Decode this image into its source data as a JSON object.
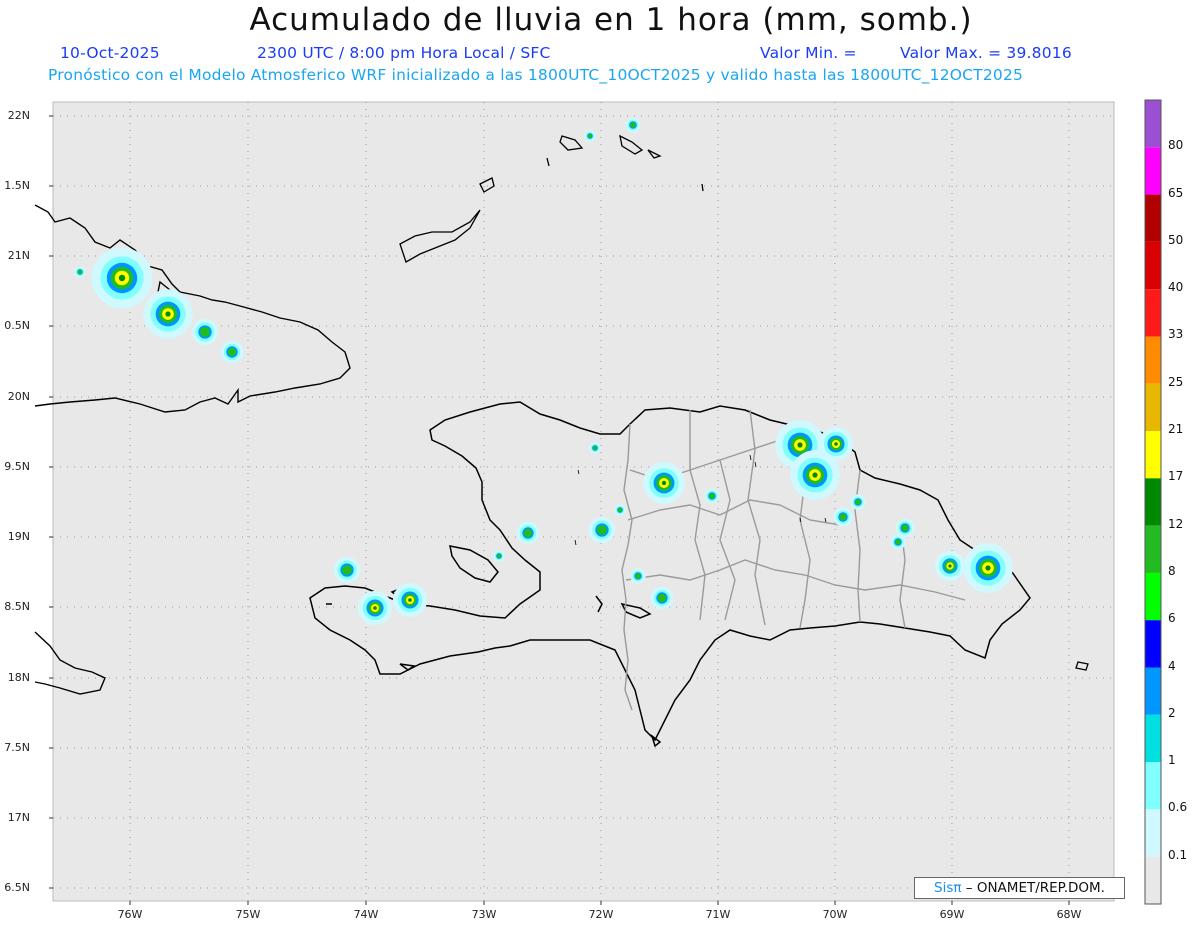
{
  "header": {
    "title": "Acumulado de lluvia en 1 hora (mm, somb.)",
    "date": "10-Oct-2025",
    "time": "2300 UTC / 8:00 pm Hora Local / SFC",
    "min_label": "Valor Min. =",
    "max_label": "Valor Max. = 39.8016",
    "subtitle": "Pronóstico con el Modelo Atmosferico WRF inicializado a las 1800UTC_10OCT2025 y valido hasta las  1800UTC_12OCT2025"
  },
  "axes": {
    "y_ticks": [
      "22N",
      "1.5N",
      "21N",
      "0.5N",
      "20N",
      "9.5N",
      "19N",
      "8.5N",
      "18N",
      "7.5N",
      "17N",
      "6.5N"
    ],
    "x_ticks": [
      "76W",
      "75W",
      "74W",
      "73W",
      "72W",
      "71W",
      "70W",
      "69W",
      "68W"
    ]
  },
  "colorbar": {
    "labels": [
      "80",
      "65",
      "50",
      "40",
      "33",
      "25",
      "21",
      "17",
      "12",
      "8",
      "6",
      "4",
      "2",
      "1",
      "0.6",
      "0.1"
    ],
    "colors": [
      "#9a50d0",
      "#ff00ff",
      "#b00000",
      "#d80000",
      "#ff1a1a",
      "#ff8c00",
      "#e8b800",
      "#ffff00",
      "#008800",
      "#22bb22",
      "#00ff00",
      "#0000ff",
      "#0096ff",
      "#00e0e0",
      "#80ffff",
      "#cff9ff",
      "#e8e8e8"
    ]
  },
  "credit": {
    "brand": "Sisπ",
    "text": " – ONAMET/REP.DOM."
  },
  "colors": {
    "map_background": "#e8e8e8",
    "coastline": "#000000",
    "borders": "#9a9a9a",
    "title_blue": "#1a3cf5",
    "subtitle_cyan": "#1aa6f0"
  }
}
